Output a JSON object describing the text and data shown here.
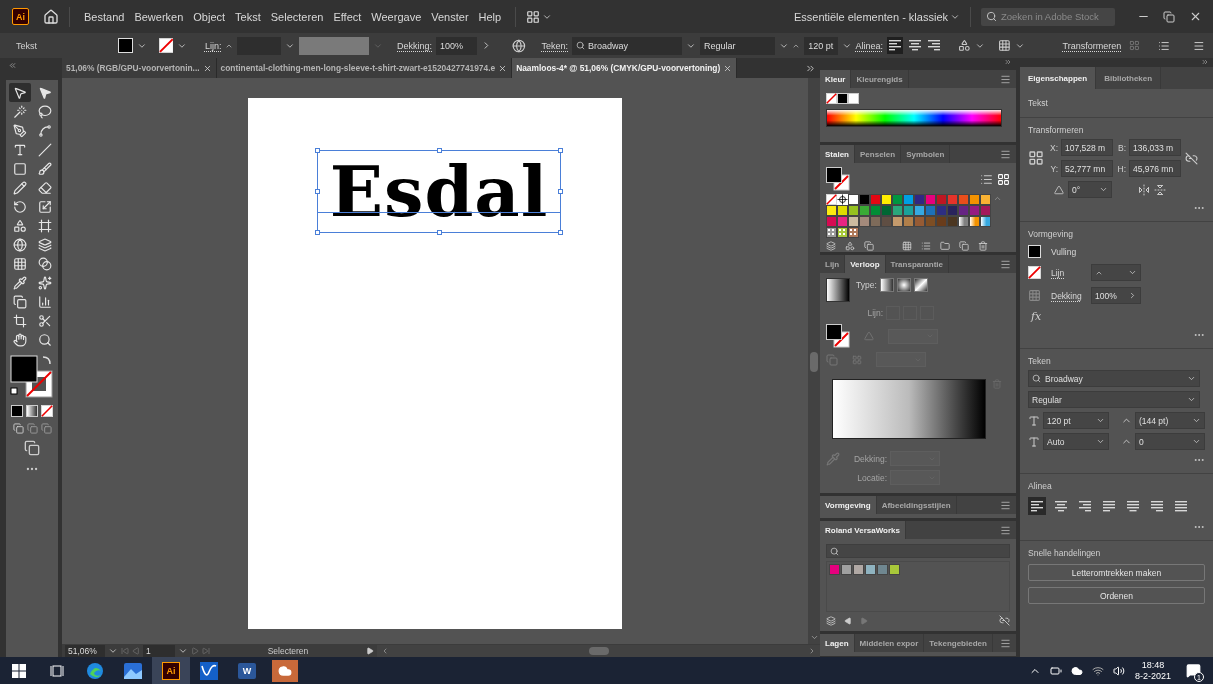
{
  "menubar": {
    "logo": "Ai",
    "menus": [
      "Bestand",
      "Bewerken",
      "Object",
      "Tekst",
      "Selecteren",
      "Effect",
      "Weergave",
      "Venster",
      "Help"
    ],
    "workspace": "Essentiële elementen - klassiek",
    "search": {
      "placeholder": "Zoeken in Adobe Stock"
    }
  },
  "control_bar": {
    "selection": "Tekst",
    "stroke_label": "Lijn:",
    "opacity_label": "Dekking:",
    "opacity": "100%",
    "char_label": "Teken:",
    "font": "Broadway",
    "style": "Regular",
    "size": "120 pt",
    "para_label": "Alinea:",
    "align": [
      {
        "selected": true
      },
      {
        "selected": false
      },
      {
        "selected": false
      }
    ],
    "transform": "Transformeren"
  },
  "doc_tabs": [
    {
      "label": "51,06% (RGB/GPU-voorvertonin...",
      "selected": false
    },
    {
      "label": "continental-clothing-men-long-sleeve-t-shirt-zwart-e1520427741974.e",
      "selected": false
    },
    {
      "label": "Naamloos-4* @ 51,06% (CMYK/GPU-voorvertoning)",
      "selected": true
    }
  ],
  "tools": [
    {
      "selected": true
    },
    {
      "selected": false
    },
    {
      "selected": false
    },
    {
      "selected": false
    },
    {
      "selected": false
    },
    {
      "selected": false
    },
    {
      "selected": false
    },
    {
      "selected": false
    },
    {
      "selected": false
    },
    {
      "selected": false
    },
    {
      "selected": false
    },
    {
      "selected": false
    },
    {
      "selected": false
    },
    {
      "selected": false
    },
    {
      "selected": false
    },
    {
      "selected": false
    },
    {
      "selected": false
    },
    {
      "selected": false
    },
    {
      "selected": false
    },
    {
      "selected": false
    },
    {
      "selected": false
    },
    {
      "selected": false
    },
    {
      "selected": false
    },
    {
      "selected": false
    },
    {
      "selected": false
    },
    {
      "selected": false
    },
    {
      "selected": false
    },
    {
      "selected": false
    }
  ],
  "artboard": {
    "text": "Esdal"
  },
  "status_bar": {
    "zoom": "51,06%",
    "page": "1",
    "tool": "Selecteren"
  },
  "color_panel": {
    "tabs": [
      {
        "label": "Kleur",
        "selected": true
      },
      {
        "label": "Kleurengids",
        "selected": false
      }
    ]
  },
  "swatches_panel": {
    "tabs": [
      {
        "label": "Stalen",
        "selected": true
      },
      {
        "label": "Penselen",
        "selected": false
      },
      {
        "label": "Symbolen",
        "selected": false
      }
    ],
    "swatches": [
      {
        "kind": "none"
      },
      {
        "kind": "registration"
      },
      {
        "kind": "solid",
        "color": "#ffffff"
      },
      {
        "kind": "solid",
        "color": "#000000"
      },
      {
        "kind": "solid",
        "color": "#e30613"
      },
      {
        "kind": "solid",
        "color": "#ffed00"
      },
      {
        "kind": "solid",
        "color": "#009640"
      },
      {
        "kind": "solid",
        "color": "#009fe3"
      },
      {
        "kind": "solid",
        "color": "#312783"
      },
      {
        "kind": "solid",
        "color": "#e6007e"
      },
      {
        "kind": "solid",
        "color": "#be1622"
      },
      {
        "kind": "solid",
        "color": "#e6332a"
      },
      {
        "kind": "solid",
        "color": "#e94e1b"
      },
      {
        "kind": "solid",
        "color": "#f39200"
      },
      {
        "kind": "solid",
        "color": "#f9b233"
      },
      {
        "kind": "solid",
        "color": "#fcea10"
      },
      {
        "kind": "solid",
        "color": "#dedc00"
      },
      {
        "kind": "solid",
        "color": "#95c11f"
      },
      {
        "kind": "solid",
        "color": "#3aaa35"
      },
      {
        "kind": "solid",
        "color": "#008d36"
      },
      {
        "kind": "solid",
        "color": "#006633"
      },
      {
        "kind": "solid",
        "color": "#2aa77b"
      },
      {
        "kind": "solid",
        "color": "#1ba29b"
      },
      {
        "kind": "solid",
        "color": "#36a9e1"
      },
      {
        "kind": "solid",
        "color": "#1d71b8"
      },
      {
        "kind": "solid",
        "color": "#2d2e83"
      },
      {
        "kind": "solid",
        "color": "#29235c"
      },
      {
        "kind": "solid",
        "color": "#662483"
      },
      {
        "kind": "solid",
        "color": "#951b81"
      },
      {
        "kind": "solid",
        "color": "#a3195b"
      },
      {
        "kind": "solid",
        "color": "#d60b52"
      },
      {
        "kind": "solid",
        "color": "#e72582"
      },
      {
        "kind": "solid",
        "color": "#cbbba0"
      },
      {
        "kind": "solid",
        "color": "#a48a7b"
      },
      {
        "kind": "solid",
        "color": "#7e6b5a"
      },
      {
        "kind": "solid",
        "color": "#5f4e43"
      },
      {
        "kind": "solid",
        "color": "#c49a6c"
      },
      {
        "kind": "solid",
        "color": "#b17f4a"
      },
      {
        "kind": "solid",
        "color": "#965b34"
      },
      {
        "kind": "solid",
        "color": "#7d4e24"
      },
      {
        "kind": "solid",
        "color": "#693c1b"
      },
      {
        "kind": "solid",
        "color": "#4b3621"
      },
      {
        "kind": "gradient",
        "color": "#808080"
      },
      {
        "kind": "gradient",
        "color": "#f39200"
      },
      {
        "kind": "gradient",
        "color": "#36a9e1"
      },
      {
        "kind": "pattern",
        "color": "#9a9a9a"
      },
      {
        "kind": "pattern",
        "color": "#a8c83a"
      },
      {
        "kind": "pattern",
        "color": "#b07a5a"
      }
    ]
  },
  "gradient_panel": {
    "tabs": [
      {
        "label": "Lijn",
        "selected": false
      },
      {
        "label": "Verloop",
        "selected": true
      },
      {
        "label": "Transparantie",
        "selected": false
      }
    ],
    "type_label": "Type:",
    "stroke_label": "Lijn:",
    "opacity_label": "Dekking:",
    "location_label": "Locatie:"
  },
  "appearance_panel": {
    "tabs": [
      {
        "label": "Vormgeving",
        "selected": true
      },
      {
        "label": "Afbeeldingsstijlen",
        "selected": false
      }
    ]
  },
  "roland_panel": {
    "tabs": [
      {
        "label": "Roland VersaWorks",
        "selected": true
      }
    ],
    "swatches": [
      {
        "color": "#e6007e"
      },
      {
        "color": "#a0a0a0"
      },
      {
        "color": "#b0a8a4"
      },
      {
        "color": "#8fb3c0"
      },
      {
        "color": "#6f8790"
      },
      {
        "color": "#a8c83a"
      }
    ]
  },
  "layers_panel": {
    "tabs": [
      {
        "label": "Lagen",
        "selected": true
      },
      {
        "label": "Middelen expor",
        "selected": false
      },
      {
        "label": "Tekengebieden",
        "selected": false
      }
    ]
  },
  "properties": {
    "tabs": [
      {
        "label": "Eigenschappen",
        "selected": true
      },
      {
        "label": "Bibliotheken",
        "selected": false
      }
    ],
    "selection": "Tekst",
    "transform": {
      "title": "Transformeren",
      "x_label": "X:",
      "x": "107,528 m",
      "w_label": "B:",
      "w": "136,033 m",
      "y_label": "Y:",
      "y": "52,777 mn",
      "h_label": "H:",
      "h": "45,976 mn",
      "angle": "0°"
    },
    "appearance": {
      "title": "Vormgeving",
      "fill": "Vulling",
      "stroke": "Lijn",
      "opacity_label": "Dekking",
      "opacity": "100%",
      "fx": "fx"
    },
    "character": {
      "title": "Teken",
      "font": "Broadway",
      "style": "Regular",
      "size": "120 pt",
      "leading": "(144 pt)",
      "kerning": "Auto",
      "tracking": "0"
    },
    "paragraph": {
      "title": "Alinea",
      "align": [
        {
          "selected": true
        },
        {
          "selected": false
        },
        {
          "selected": false
        },
        {
          "selected": false
        },
        {
          "selected": false
        },
        {
          "selected": false
        },
        {
          "selected": false
        }
      ]
    },
    "quick_actions": {
      "title": "Snelle handelingen",
      "buttons": [
        "Letteromtrekken maken",
        "Ordenen"
      ]
    }
  },
  "taskbar": {
    "apps": [
      {
        "kind": "start",
        "selected": false
      },
      {
        "kind": "taskview",
        "selected": false
      },
      {
        "kind": "browser",
        "selected": false
      },
      {
        "kind": "photos",
        "selected": false
      },
      {
        "kind": "illustrator",
        "label": "Ai",
        "selected": true
      },
      {
        "kind": "wave",
        "selected": false
      },
      {
        "kind": "word",
        "label": "W",
        "selected": false
      },
      {
        "kind": "cloud",
        "selected": false
      }
    ],
    "time": "18:48",
    "date": "8-2-2021",
    "notifications": "1"
  }
}
